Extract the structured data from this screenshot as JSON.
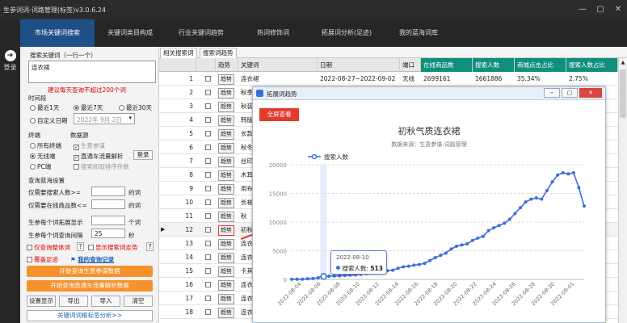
{
  "window": {
    "title": "生参词词-词路管理(标签)v3.0.6.24",
    "minimize_glyph": "—",
    "restore_glyph": "▢",
    "close_glyph": "✕"
  },
  "left_bar": {
    "login_icon": "log-in-icon",
    "login_glyph": "➜",
    "login_label": "登录"
  },
  "nav": {
    "tabs": [
      {
        "label": "市场关键词搜索"
      },
      {
        "label": "关键词类目构成"
      },
      {
        "label": "行业关键词趋势"
      },
      {
        "label": "热词修饰词"
      },
      {
        "label": "拓展词分析(足迹)"
      },
      {
        "label": "我的蓝海词库"
      }
    ]
  },
  "search_panel": {
    "keywords_label": "搜索关键词（一行一个）",
    "keywords_value": "连衣裙",
    "hint": "建议每天查询不超过200个词",
    "time_label": "时间段",
    "time_options": [
      "最近1天",
      "最近7天",
      "最近30天"
    ],
    "custom_date_label": "自定义日期",
    "custom_date_value": "2022年 9月 2日",
    "terminal_label": "终端",
    "terminal_options": [
      "所有终端",
      "无线端",
      "PC端"
    ],
    "source_label": "数据源",
    "source_options": [
      "生意参谋",
      "直通车流量解析",
      "搜索抓取排序件数"
    ],
    "login_btn": "登录",
    "bluesea_label": "查询蓝海设置",
    "min_search_label": "仅需要搜索人数>=",
    "min_search_unit": "的词",
    "max_goods_label": "仅需要在线商品数<=",
    "max_goods_unit": "的词",
    "max_expand_label": "生参每个词拓展显示",
    "max_expand_unit": "个词",
    "interval_label": "生参每个词查询间隔",
    "interval_value": "25",
    "interval_unit": "秒",
    "chk_query_words": "仅查询整体词",
    "chk_show_trend": "显示搜索词走势",
    "question_glyph": "?",
    "chk_footprint": "覆盖足迹",
    "my_query_link": "我的查询记录",
    "btn_start_sycm": "开始查询生意参谋数据",
    "btn_start_ztc": "开始查询直通车流量解析数据",
    "btn_settings": "设置显示",
    "btn_export": "导出",
    "btn_import": "导入",
    "btn_clear": "清空",
    "btn_bottom": "关键词词根标签分析>>"
  },
  "sub_tabs": [
    "相关搜索词",
    "搜索词趋势"
  ],
  "table": {
    "headers": [
      "趋势",
      "关键词",
      "日期",
      "端口",
      "在线商品数",
      "搜索人数",
      "商城点击占比",
      "搜索人数占比"
    ],
    "trend_btn": "趋势",
    "selected_row_marker": "▶",
    "rows": [
      {
        "n": "1",
        "kw": "连衣裙",
        "date": "2022-08-27~2022-09-02",
        "port": "无线",
        "goods": "2699161",
        "search": "1661886",
        "mall": "35.34%",
        "share": "2.75%"
      },
      {
        "n": "2",
        "kw": "秋季"
      },
      {
        "n": "3",
        "kw": "秋装"
      },
      {
        "n": "4",
        "kw": "韩版"
      },
      {
        "n": "5",
        "kw": "长款"
      },
      {
        "n": "6",
        "kw": "秋冬"
      },
      {
        "n": "7",
        "kw": "丝印"
      },
      {
        "n": "8",
        "kw": "木耳"
      },
      {
        "n": "9",
        "kw": "用布"
      },
      {
        "n": "10",
        "kw": "长袖"
      },
      {
        "n": "11",
        "kw": "秋"
      },
      {
        "n": "12",
        "kw": "初秋"
      },
      {
        "n": "13",
        "kw": "连衣"
      },
      {
        "n": "14",
        "kw": "连衣"
      },
      {
        "n": "15",
        "kw": "卡其"
      },
      {
        "n": "16",
        "kw": "连衣"
      },
      {
        "n": "17",
        "kw": "连衣"
      },
      {
        "n": "18",
        "kw": "连衣"
      }
    ]
  },
  "popup": {
    "title": "拓展词趋势",
    "fullscreen_btn": "全屏查看",
    "chart_title": "初秋气质连衣裙",
    "chart_subtitle": "数据来源：生意参谋-词路管理",
    "tooltip_date": "2022-08-10",
    "tooltip_label": "搜索人数",
    "tooltip_value": "513"
  },
  "chart_data": {
    "type": "line",
    "title": "初秋气质连衣裙",
    "subtitle": "数据来源：生意参谋-词路管理",
    "series": [
      {
        "name": "搜索人数",
        "color": "#3a6fd8",
        "values": [
          20,
          30,
          40,
          100,
          150,
          300,
          513,
          560,
          590,
          620,
          680,
          750,
          800,
          900,
          1000,
          1100,
          1300,
          1480,
          1520,
          1600,
          1950,
          2200,
          2300,
          2480,
          2600,
          2800,
          3300,
          3800,
          4200,
          4600,
          5300,
          5800,
          6000,
          6200,
          6800,
          7200,
          7500,
          8500,
          9000,
          9400,
          9800,
          10500,
          11500,
          12500,
          13500,
          14000,
          14200,
          14000,
          15500,
          17000,
          18200,
          18600,
          18400,
          18600,
          16000,
          12800
        ]
      }
    ],
    "x_tick_labels": [
      "2022-08-04",
      "2022-08-06",
      "2022-08-08",
      "2022-08-10",
      "2022-08-12",
      "2022-08-14",
      "2022-08-16",
      "2022-08-18",
      "2022-08-20",
      "2022-08-22",
      "2022-08-24",
      "2022-08-26",
      "2022-08-28",
      "2022-08-30",
      "2022-09-01"
    ],
    "y_ticks": [
      0,
      5000,
      10000,
      15000,
      20000
    ],
    "ylim": [
      0,
      20000
    ],
    "legend_position": "top-left",
    "grid": "horizontal dashed",
    "highlight_index": 6
  },
  "colors": {
    "nav_active": "#1e4f86",
    "teal_header": "#0f8f7e",
    "orange_btn": "#f5922e",
    "red_btn": "#e23b2e",
    "line": "#3a6fd8"
  }
}
